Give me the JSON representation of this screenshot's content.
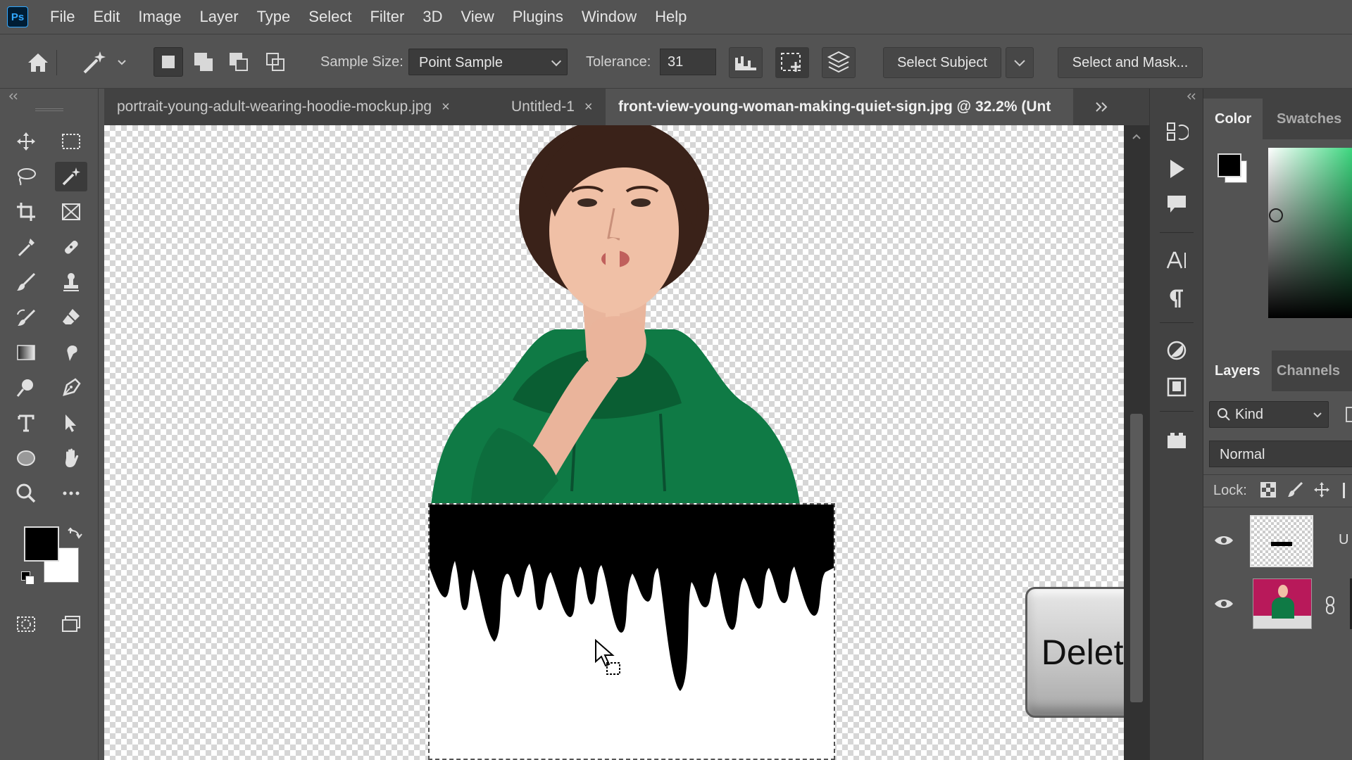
{
  "app": {
    "logo": "Ps"
  },
  "menu": [
    "File",
    "Edit",
    "Image",
    "Layer",
    "Type",
    "Select",
    "Filter",
    "3D",
    "View",
    "Plugins",
    "Window",
    "Help"
  ],
  "options": {
    "sample_size_label": "Sample Size:",
    "sample_size_value": "Point Sample",
    "tolerance_label": "Tolerance:",
    "tolerance_value": "31",
    "select_subject": "Select Subject",
    "select_and_mask": "Select and Mask..."
  },
  "tabs": [
    {
      "label": "portrait-young-adult-wearing-hoodie-mockup.jpg",
      "close": "×"
    },
    {
      "label": "Untitled-1",
      "close": "×"
    },
    {
      "label": "front-view-young-woman-making-quiet-sign.jpg @ 32.2% (Unt"
    }
  ],
  "overlay": {
    "delete_key": "Delete"
  },
  "panels": {
    "color_tab": "Color",
    "swatches_tab": "Swatches",
    "layers_tab": "Layers",
    "channels_tab": "Channels",
    "filter_kind": "Kind",
    "blend_mode": "Normal",
    "lock_label": "Lock:",
    "layer1_label_fragment": "U"
  },
  "colors": {
    "foreground": "#000000",
    "background": "#ffffff",
    "accent": "#31a8ff",
    "hoodie": "#0f7a45"
  }
}
